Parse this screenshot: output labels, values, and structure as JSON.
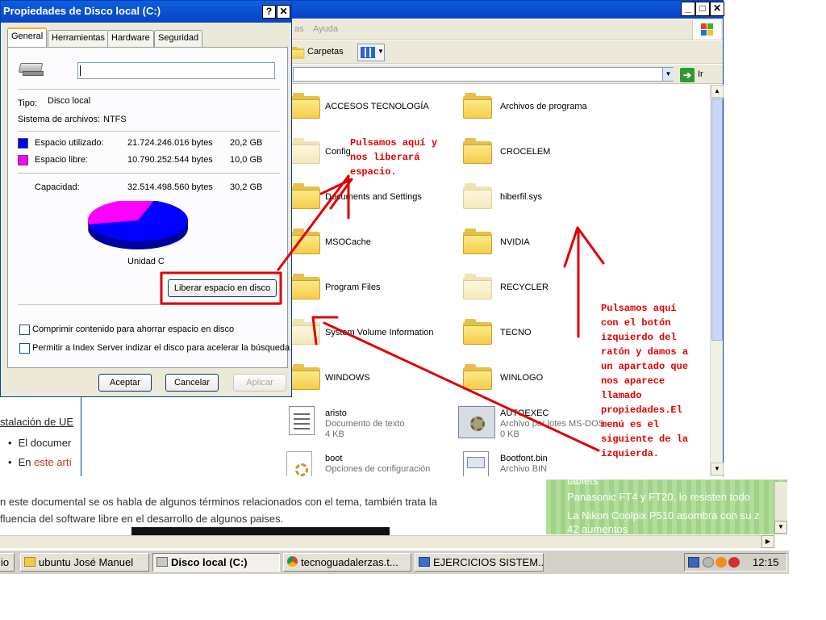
{
  "webpage": {
    "link_text": "stalación de UE",
    "bullets": [
      {
        "plain": "El documer",
        "red": ""
      },
      {
        "plain": "En ",
        "red": "este artí"
      }
    ],
    "paragraph_lines": [
      "n este documental se os habla de algunos términos relacionados con el tema, también trata la",
      "fluencia del software libre en el desarrollo de algunos paises."
    ],
    "sidebar_lines": [
      "tablets",
      "Panasonic FT4 y FT20, lo resisten todo",
      "La Nikon Coolpix P510 asombra con su z",
      "42 aumentos"
    ]
  },
  "explorer": {
    "menu_partial": "as",
    "menu_help": "Ayuda",
    "toolbar_folders": "Carpetas",
    "go_label": "Ir",
    "items": [
      {
        "name": "ACCESOS TECNOLOGÍA",
        "kind": "folder"
      },
      {
        "name": "Archivos de programa",
        "kind": "folder"
      },
      {
        "name": "Config",
        "kind": "folder-pale"
      },
      {
        "name": "CROCELEM",
        "kind": "folder"
      },
      {
        "name": "Documents and Settings",
        "kind": "folder"
      },
      {
        "name": "hiberfil.sys",
        "kind": "folder-pale"
      },
      {
        "name": "MSOCache",
        "kind": "folder"
      },
      {
        "name": "NVIDIA",
        "kind": "folder"
      },
      {
        "name": "Program Files",
        "kind": "folder"
      },
      {
        "name": "RECYCLER",
        "kind": "folder-pale"
      },
      {
        "name": "System Volume Information",
        "kind": "folder-pale"
      },
      {
        "name": "TECNO",
        "kind": "folder"
      },
      {
        "name": "WINDOWS",
        "kind": "folder"
      },
      {
        "name": "WINLOGO",
        "kind": "folder"
      }
    ],
    "files": [
      {
        "name": "aristo",
        "type": "Documento de texto",
        "size": "4 KB"
      },
      {
        "name": "AUTOEXEC",
        "type": "Archivo por lotes MS-DOS",
        "size": "0 KB"
      },
      {
        "name": "boot",
        "type": "Opciones de configuración",
        "size": ""
      },
      {
        "name": "Bootfont.bin",
        "type": "Archivo BIN",
        "size": ""
      }
    ]
  },
  "dialog": {
    "title": "Propiedades de Disco local (C:)",
    "tabs": [
      "General",
      "Herramientas",
      "Hardware",
      "Seguridad"
    ],
    "label_value": "",
    "type_label": "Tipo:",
    "type_value": "Disco local",
    "fs_label": "Sistema de archivos:",
    "fs_value": "NTFS",
    "used_label": "Espacio utilizado:",
    "used_bytes": "21.724.246.016 bytes",
    "used_gb": "20,2 GB",
    "free_label": "Espacio libre:",
    "free_bytes": "10.790.252.544 bytes",
    "free_gb": "10,0 GB",
    "capacity_label": "Capacidad:",
    "capacity_bytes": "32.514.498.560 bytes",
    "capacity_gb": "30,2 GB",
    "drive_label": "Unidad C",
    "cleanup_button": "Liberar espacio en disco",
    "compress_label": "Comprimir contenido para ahorrar espacio en disco",
    "index_label": "Permitir a Index Server indizar el disco para acelerar la búsqueda",
    "ok_button": "Aceptar",
    "cancel_button": "Cancelar",
    "apply_button": "Aplicar",
    "used_color": "#0000ff",
    "free_color": "#ff00ff",
    "used_fraction": 0.668
  },
  "annotations": {
    "note_button": "Pulsamos aquí y\nnos liberará\nespacio.",
    "note_properties": "Pulsamos aquí\ncon el botón\nizquierdo del\nratón y damos a\nun apartado que\nnos aparece\nllamado\npropiedades.El\nmenú es el\nsiguiente de la\nizquierda."
  },
  "taskbar": {
    "items": [
      {
        "label": "io",
        "icon": "generic-icon"
      },
      {
        "label": "ubuntu José Manuel",
        "icon": "folder-icon"
      },
      {
        "label": "Disco local (C:)",
        "icon": "drive-icon",
        "active": true
      },
      {
        "label": "tecnoguadalerzas.t...",
        "icon": "chrome-icon"
      },
      {
        "label": "EJERCICIOS SISTEM...",
        "icon": "editor-icon"
      }
    ],
    "clock": "12:15"
  }
}
